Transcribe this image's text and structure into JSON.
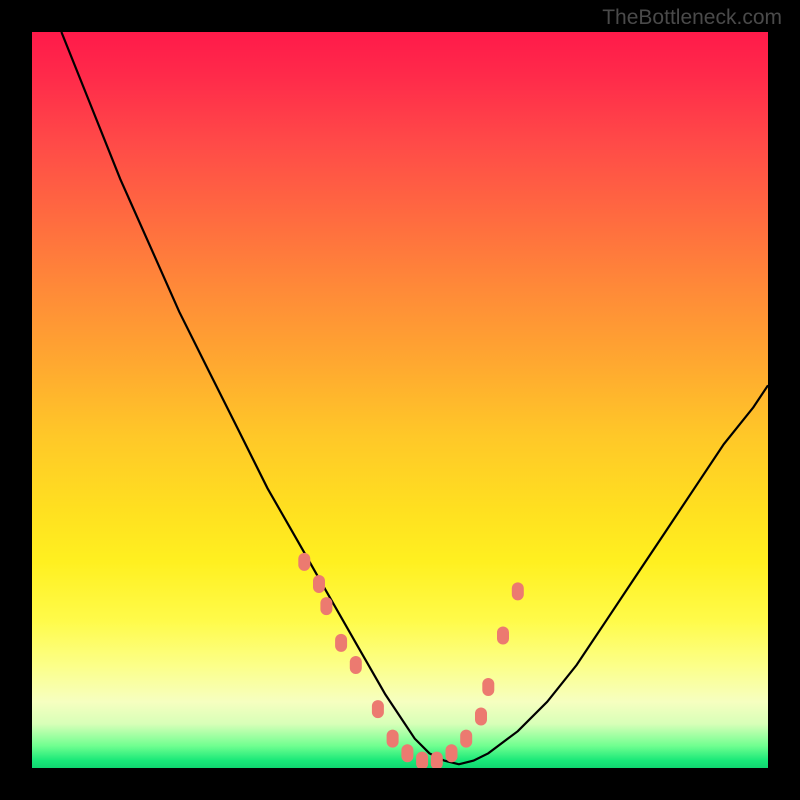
{
  "attribution": "TheBottleneck.com",
  "chart_data": {
    "type": "line",
    "title": "",
    "xlabel": "",
    "ylabel": "",
    "xlim": [
      0,
      100
    ],
    "ylim": [
      0,
      100
    ],
    "background_gradient": {
      "orientation": "vertical",
      "stops": [
        {
          "pos": 0,
          "color": "#ff1a4a"
        },
        {
          "pos": 0.5,
          "color": "#ffc828"
        },
        {
          "pos": 0.86,
          "color": "#fcff88"
        },
        {
          "pos": 0.99,
          "color": "#18e878"
        }
      ]
    },
    "series": [
      {
        "name": "bottleneck-curve",
        "color": "#000000",
        "x": [
          4,
          8,
          12,
          16,
          20,
          24,
          28,
          32,
          36,
          40,
          44,
          48,
          50,
          52,
          54,
          56,
          58,
          60,
          62,
          66,
          70,
          74,
          78,
          82,
          86,
          90,
          94,
          98,
          100
        ],
        "y": [
          100,
          90,
          80,
          71,
          62,
          54,
          46,
          38,
          31,
          24,
          17,
          10,
          7,
          4,
          2,
          1,
          0.5,
          1,
          2,
          5,
          9,
          14,
          20,
          26,
          32,
          38,
          44,
          49,
          52
        ]
      },
      {
        "name": "marker-points",
        "color": "#ec7a70",
        "type": "scatter",
        "x": [
          37,
          39,
          40,
          42,
          44,
          47,
          49,
          51,
          53,
          55,
          57,
          59,
          61,
          62,
          64,
          66
        ],
        "y": [
          28,
          25,
          22,
          17,
          14,
          8,
          4,
          2,
          1,
          1,
          2,
          4,
          7,
          11,
          18,
          24
        ]
      }
    ],
    "annotation": {
      "minimum_at_x": 57,
      "minimum_value": 0.5,
      "shape": "asymmetric-v"
    }
  }
}
